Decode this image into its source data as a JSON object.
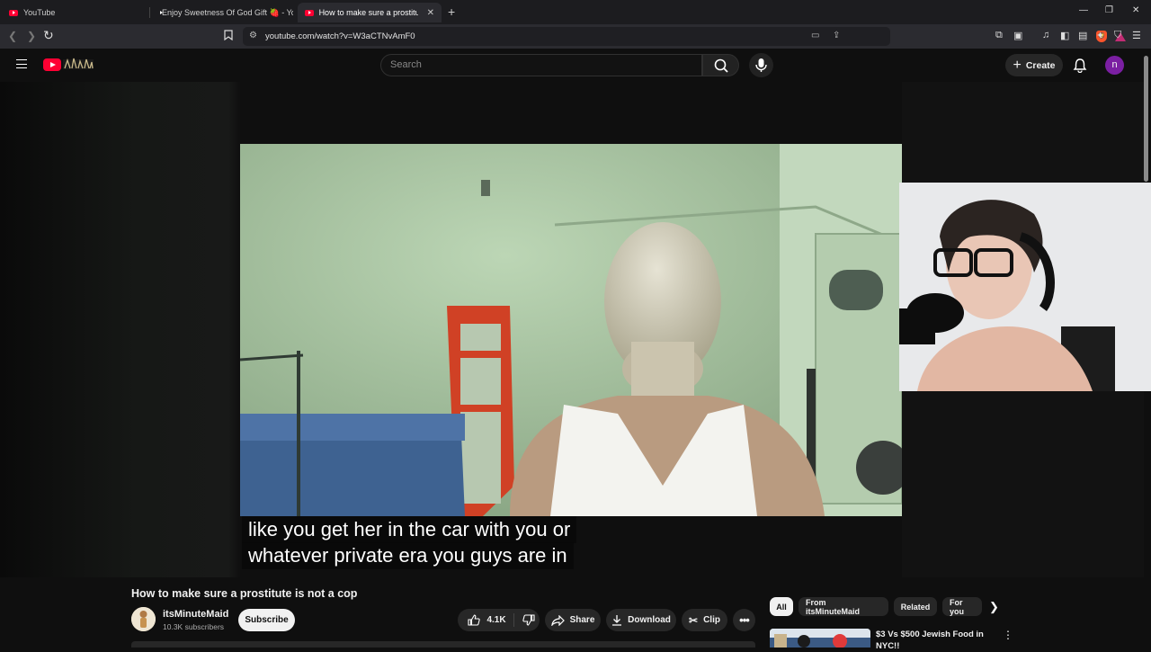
{
  "browser": {
    "tabs": [
      {
        "title": "YouTube"
      },
      {
        "title": "Enjoy Sweetness Of God Gift 🍓 - Yo"
      },
      {
        "title": "How to make sure a prostitute is"
      }
    ],
    "url": "youtube.com/watch?v=W3aCTNvAmF0"
  },
  "header": {
    "search_placeholder": "Search",
    "create_label": "Create",
    "avatar_letter": "n"
  },
  "player": {
    "caption_line1": "like you get her in the car with you or",
    "caption_line2": "whatever private era you guys are in"
  },
  "video": {
    "title": "How to make sure a prostitute is not a cop",
    "channel_name": "itsMinuteMaid",
    "subscribers": "10.3K subscribers",
    "subscribe_label": "Subscribe",
    "like_count": "4.1K",
    "share_label": "Share",
    "download_label": "Download",
    "clip_label": "Clip"
  },
  "sidebar": {
    "chips": [
      "All",
      "From itsMinuteMaid",
      "Related",
      "For you"
    ],
    "recommendations": [
      {
        "title": "$3 Vs $500 Jewish Food in NYC!!"
      }
    ]
  },
  "colors": {
    "youtube_red": "#ff0033",
    "background": "#0f0f0f",
    "pill": "#272727",
    "avatar": "#7b1fa2"
  }
}
